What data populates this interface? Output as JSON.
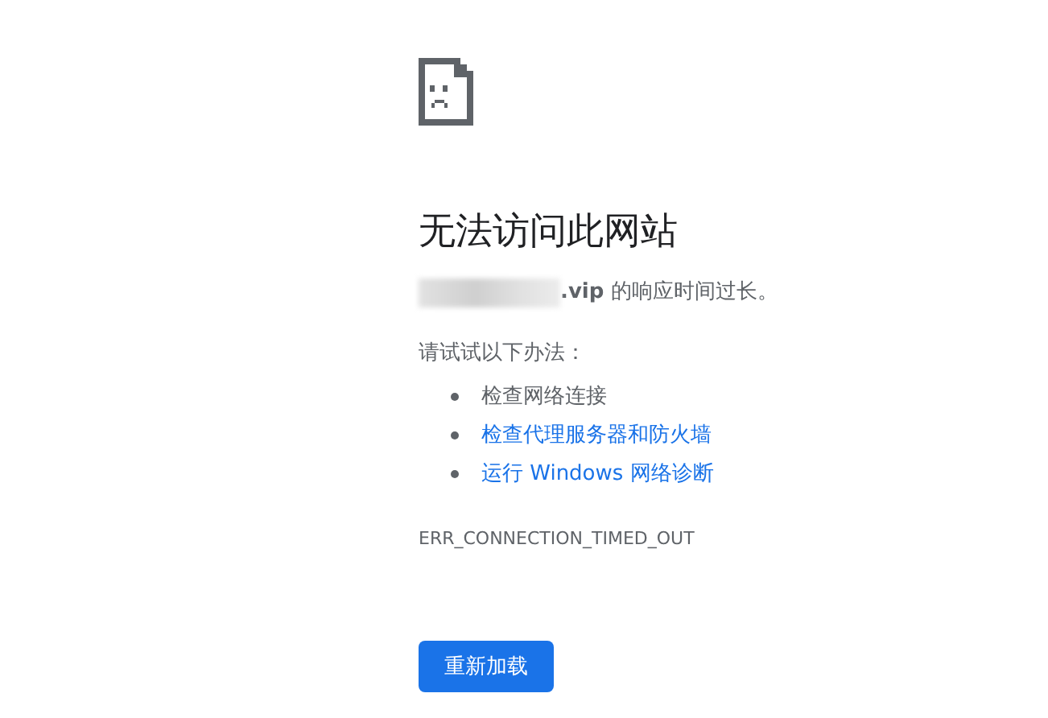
{
  "title": "无法访问此网站",
  "message": "**.vip** 的响应时间过长。",
  "suggestions_heading": "请试试以下办法：",
  "suggestions": [
    {
      "kind": "text",
      "label": "检查网络连接"
    },
    {
      "kind": "link",
      "label": "检查代理服务器和防火墙"
    },
    {
      "kind": "link",
      "label": "运行 Windows 网络诊断"
    }
  ],
  "error_code": "ERR_CONNECTION_TIMED_OUT",
  "reload_button": "重新加载"
}
